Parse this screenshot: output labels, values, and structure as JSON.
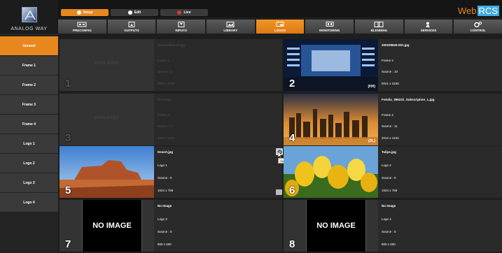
{
  "brand": {
    "name": "ANALOG WAY",
    "app": "Web",
    "app_suffix": "RCS",
    "accent": "#e8871e"
  },
  "modes": [
    {
      "label": "Setup",
      "icon": "gear-icon",
      "active": true
    },
    {
      "label": "Edit",
      "icon": "edit-icon",
      "active": false
    },
    {
      "label": "Live",
      "icon": "live-icon",
      "active": false
    }
  ],
  "nav_tabs": [
    {
      "label": "PRECONFIG",
      "icon": "preconfig-icon"
    },
    {
      "label": "OUTPUTS",
      "icon": "outputs-icon"
    },
    {
      "label": "INPUTS",
      "icon": "inputs-icon"
    },
    {
      "label": "LIBRARY",
      "icon": "library-icon"
    },
    {
      "label": "LOGOS",
      "icon": "logos-icon",
      "active": true
    },
    {
      "label": "MONITORING",
      "icon": "monitoring-icon"
    },
    {
      "label": "BLENDING",
      "icon": "blending-icon"
    },
    {
      "label": "SERVICES",
      "icon": "services-icon"
    },
    {
      "label": "CONTROL",
      "icon": "control-icon"
    }
  ],
  "sidebar": [
    {
      "label": "General",
      "active": true
    },
    {
      "label": "Frame 1"
    },
    {
      "label": "Frame 2"
    },
    {
      "label": "Frame 3"
    },
    {
      "label": "Frame 4"
    },
    {
      "label": "Logo 1"
    },
    {
      "label": "Logo 2"
    },
    {
      "label": "Logo 3"
    },
    {
      "label": "Logo 4"
    }
  ],
  "cells": [
    {
      "num": "1",
      "enslaved": "ENSLAVED",
      "file": "Livesmethemes.jpg",
      "slot": "Frame 1",
      "source": "Source : 1",
      "size": "3840 x 2160"
    },
    {
      "num": "2",
      "tag": "(HH)",
      "file": "200109625-001.jpg",
      "slot": "Frame 2",
      "source": "Source : 10",
      "size": "5041 x 3180"
    },
    {
      "num": "3",
      "enslaved": "ENSLAVED",
      "file": "No Image",
      "slot": "Frame 3",
      "source": "Source : 0",
      "size": "1920 x 1242"
    },
    {
      "num": "4",
      "tag": "(DL)",
      "file": "Fotolia_396232_Subscription_L.jpg",
      "slot": "Frame 4",
      "source": "Source : 11",
      "size": "2012 x 1242"
    },
    {
      "num": "5",
      "file": "Desert.jpg",
      "slot": "Logo 1",
      "source": "Source : 0",
      "size": "1024 x 768",
      "tooltip": "Setup"
    },
    {
      "num": "6",
      "file": "Tulips.jpg",
      "slot": "Logo 2",
      "source": "Source : 0",
      "size": "1024 x 768"
    },
    {
      "num": "7",
      "noimage": "NO IMAGE",
      "file": "No Image",
      "slot": "Logo 3",
      "source": "Source : 0",
      "size": "800 x 600"
    },
    {
      "num": "8",
      "noimage": "NO IMAGE",
      "file": "No Image",
      "slot": "Logo 4",
      "source": "Source : 0",
      "size": "800 x 600"
    }
  ]
}
